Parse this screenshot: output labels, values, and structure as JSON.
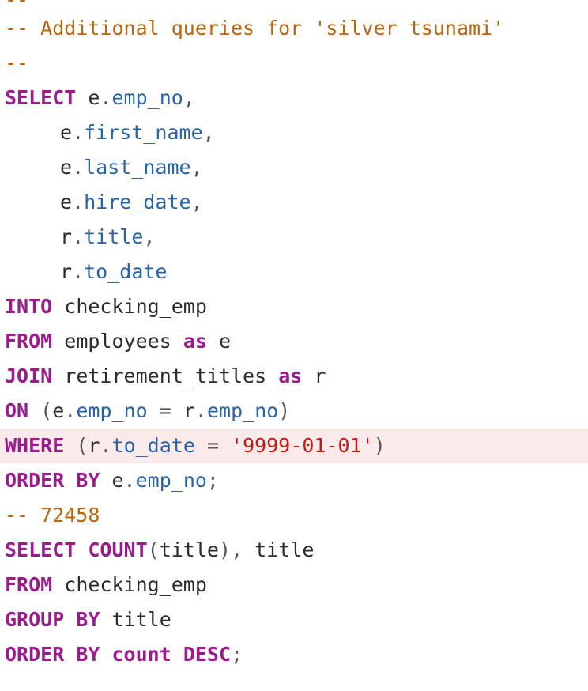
{
  "code": {
    "l1": "--",
    "l2": "-- Additional queries for 'silver tsunami'",
    "l3": "--",
    "select_kw": "SELECT",
    "e": "e",
    "dot": ".",
    "comma": ",",
    "r": "r",
    "f_emp_no": "emp_no",
    "f_first_name": "first_name",
    "f_last_name": "last_name",
    "f_hire_date": "hire_date",
    "f_title": "title",
    "f_to_date": "to_date",
    "into_kw": "INTO",
    "checking_emp": "checking_emp",
    "from_kw": "FROM",
    "employees": "employees",
    "as_kw": "as",
    "join_kw": "JOIN",
    "retirement_titles": "retirement_titles",
    "on_kw": "ON",
    "lparen": "(",
    "rparen": ")",
    "eq": "=",
    "where_kw": "WHERE",
    "date_literal": "'9999-01-01'",
    "order_by_kw": "ORDER BY",
    "semicolon": ";",
    "count_comment": "-- 72458",
    "count_fn": "COUNT",
    "title_word": "title",
    "group_by_kw": "GROUP BY",
    "count_word": "count",
    "desc_kw": "DESC"
  },
  "colors": {
    "keyword": "#9a1c8c",
    "field": "#2763a8",
    "string": "#c41a16",
    "comment": "#b8650e",
    "highlight_bg": "#faeaea"
  }
}
